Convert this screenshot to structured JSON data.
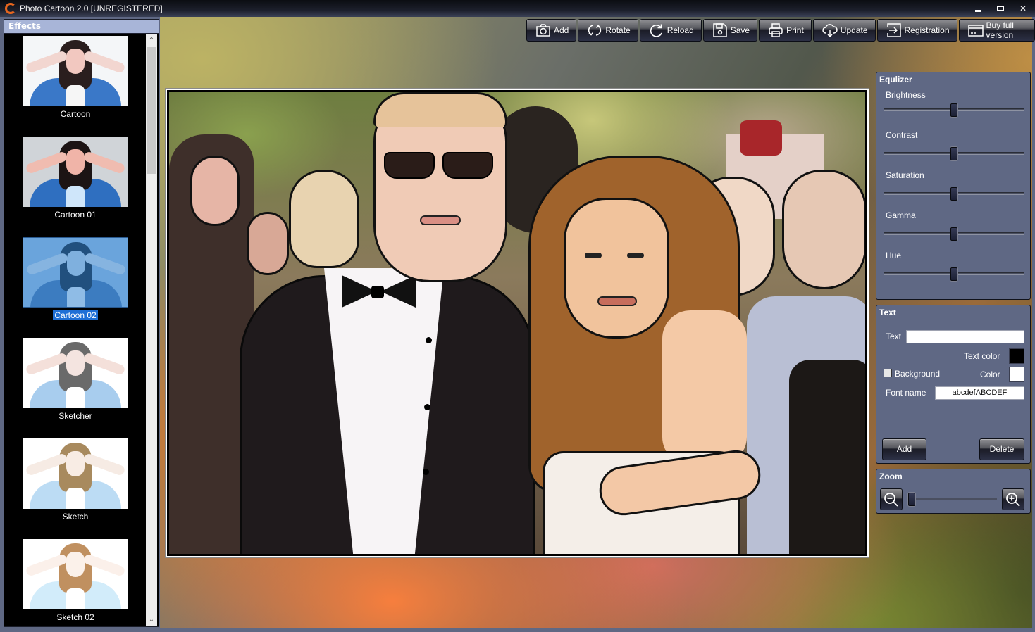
{
  "window": {
    "title": "Photo Cartoon 2.0 [UNREGISTERED]",
    "controls": {
      "minimize": "minimize-icon",
      "maximize": "maximize-icon",
      "close": "close-icon",
      "close_glyph": "✕"
    }
  },
  "toolbar": {
    "buttons": [
      {
        "label": "Add",
        "icon": "camera-icon"
      },
      {
        "label": "Rotate",
        "icon": "rotate-icon"
      },
      {
        "label": "Reload",
        "icon": "reload-icon"
      },
      {
        "label": "Save",
        "icon": "floppy-disk-icon"
      },
      {
        "label": "Print",
        "icon": "printer-icon"
      },
      {
        "label": "Update",
        "icon": "cloud-download-icon"
      },
      {
        "label": "Registration",
        "icon": "sign-in-icon"
      },
      {
        "label": "Buy full version",
        "icon": "credit-card-icon"
      }
    ]
  },
  "effects": {
    "title": "Effects",
    "selected": "Cartoon 02",
    "items": [
      {
        "label": "Cartoon"
      },
      {
        "label": "Cartoon 01"
      },
      {
        "label": "Cartoon 02"
      },
      {
        "label": "Sketcher"
      },
      {
        "label": "Sketch"
      },
      {
        "label": "Sketch 02"
      }
    ],
    "scroll_up_glyph": "⌃",
    "scroll_down_glyph": "⌄"
  },
  "equalizer": {
    "title": "Equlizer",
    "sliders": [
      {
        "label": "Brightness",
        "value": 0.5
      },
      {
        "label": "Contrast",
        "value": 0.5
      },
      {
        "label": "Saturation",
        "value": 0.5
      },
      {
        "label": "Gamma",
        "value": 0.5
      },
      {
        "label": "Hue",
        "value": 0.5
      }
    ]
  },
  "text_panel": {
    "title": "Text",
    "text_label": "Text",
    "text_value": "",
    "text_color_label": "Text color",
    "text_color": "#000000",
    "background_label": "Background",
    "background_checked": false,
    "color_label": "Color",
    "background_color": "#ffffff",
    "font_name_label": "Font name",
    "font_name_value": "abcdefABCDEF",
    "add_label": "Add",
    "delete_label": "Delete"
  },
  "zoom_panel": {
    "title": "Zoom",
    "value": 0.0,
    "zoom_out_icon": "zoom-out-icon",
    "zoom_in_icon": "zoom-in-icon"
  },
  "colors": {
    "panel_bg": "#5f6884",
    "effects_header": "#a8b5d8",
    "selection": "#1f6fd6"
  }
}
